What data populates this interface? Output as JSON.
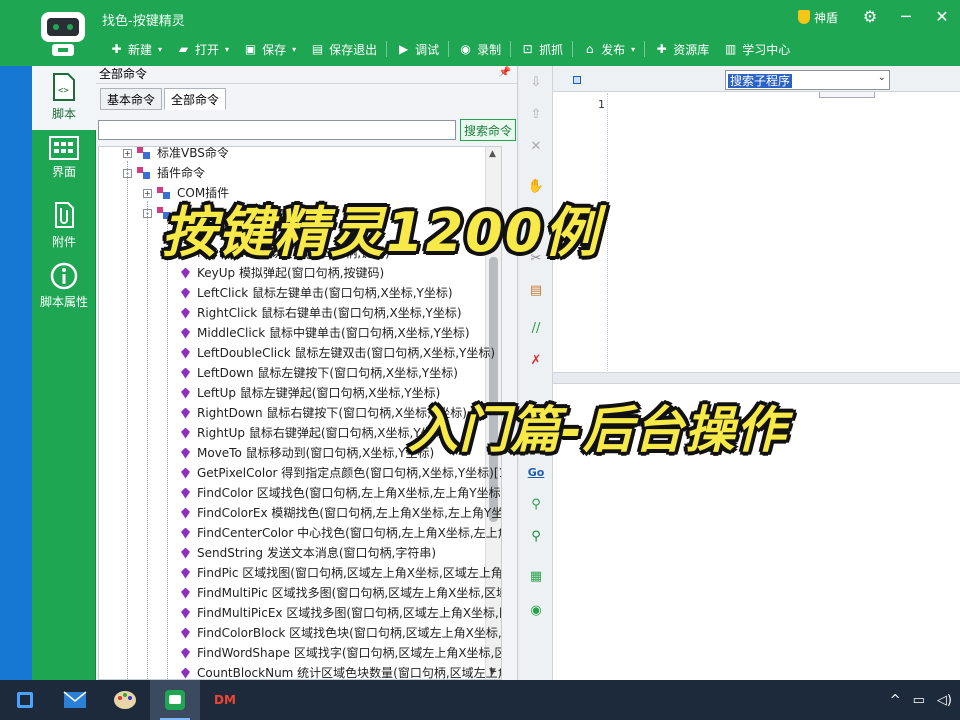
{
  "window": {
    "title": "找色-按键精灵"
  },
  "topbar": {
    "shield_label": "神盾",
    "toolbar": [
      {
        "icon": "plus-icon",
        "label": "新建",
        "dropdown": true
      },
      {
        "icon": "folder-open-icon",
        "label": "打开",
        "dropdown": true
      },
      {
        "icon": "save-icon",
        "label": "保存",
        "dropdown": true
      },
      {
        "icon": "save-exit-icon",
        "label": "保存退出",
        "dropdown": false
      },
      {
        "icon": "play-icon",
        "label": "调试",
        "dropdown": false
      },
      {
        "icon": "record-icon",
        "label": "录制",
        "dropdown": false
      },
      {
        "icon": "capture-icon",
        "label": "抓抓",
        "dropdown": false
      },
      {
        "icon": "publish-icon",
        "label": "发布",
        "dropdown": true
      },
      {
        "icon": "resource-icon",
        "label": "资源库",
        "dropdown": false
      },
      {
        "icon": "study-icon",
        "label": "学习中心",
        "dropdown": false
      }
    ]
  },
  "nav": {
    "items": [
      {
        "label": "脚本",
        "icon": "script-icon",
        "active": true
      },
      {
        "label": "界面",
        "icon": "ui-grid-icon",
        "active": false
      },
      {
        "label": "附件",
        "icon": "attachment-icon",
        "active": false
      },
      {
        "label": "脚本属性",
        "icon": "info-icon",
        "active": false
      }
    ]
  },
  "panel": {
    "title": "全部命令",
    "tabs": [
      "基本命令",
      "全部命令"
    ],
    "active_tab": 1,
    "search_value": "",
    "search_button": "搜索命令",
    "tree_roots": [
      {
        "label": "标准VBS命令",
        "expander": "+"
      },
      {
        "label": "插件命令",
        "expander": "-"
      }
    ],
    "tree_sub": [
      {
        "label": "COM插件",
        "expander": "+"
      },
      {
        "label": "",
        "expander": "-"
      }
    ],
    "commands": [
      "KeyDown 模拟按下(窗口句柄,键码)",
      "KeyUp 模拟弹起(窗口句柄,按键码)",
      "LeftClick 鼠标左键单击(窗口句柄,X坐标,Y坐标)",
      "RightClick 鼠标右键单击(窗口句柄,X坐标,Y坐标)",
      "MiddleClick 鼠标中键单击(窗口句柄,X坐标,Y坐标)",
      "LeftDoubleClick 鼠标左键双击(窗口句柄,X坐标,Y坐标)",
      "LeftDown 鼠标左键按下(窗口句柄,X坐标,Y坐标)",
      "LeftUp 鼠标左键弹起(窗口句柄,X坐标,Y坐标)",
      "RightDown 鼠标右键按下(窗口句柄,X坐标,Y坐标)",
      "RightUp 鼠标右键弹起(窗口句柄,X坐标,Y坐标)",
      "MoveTo 鼠标移动到(窗口句柄,X坐标,Y坐标)",
      "GetPixelColor 得到指定点颜色(窗口句柄,X坐标,Y坐标)[16",
      "FindColor 区域找色(窗口句柄,左上角X坐标,左上角Y坐标,",
      "FindColorEx 模糊找色(窗口句柄,左上角X坐标,左上角Y坐",
      "FindCenterColor 中心找色(窗口句柄,左上角X坐标,左上角",
      "SendString 发送文本消息(窗口句柄,字符串)",
      "FindPic 区域找图(窗口句柄,区域左上角X坐标,区域左上角Y",
      "FindMultiPic 区域找多图(窗口句柄,区域左上角X坐标,区域",
      "FindMultiPicEx 区域找多图(窗口句柄,区域左上角X坐标,区",
      "FindColorBlock 区域找色块(窗口句柄,区域左上角X坐标,区",
      "FindWordShape 区域找字(窗口句柄,区域左上角X坐标,区域",
      "CountBlockNum 统计区域色块数量(窗口句柄,区域左上角"
    ]
  },
  "vtoolbar": [
    "arrow-down-icon",
    "arrow-up-icon",
    "close-x-icon",
    "hand-icon",
    "copy-icon",
    "cut-icon",
    "paste-icon",
    "comment-icon",
    "uncomment-icon",
    "goto-icon",
    "find-icon",
    "replace-icon",
    "list-icon",
    "eye-icon"
  ],
  "editor": {
    "subroutine_select": "搜索子程序",
    "line_number": "1"
  },
  "captions": {
    "title": "按键精灵1200例",
    "subtitle": "入门篇-后台操作"
  },
  "taskbar": {
    "apps": [
      "start-icon",
      "mail-icon",
      "paint-icon",
      "anjian-app-icon",
      "dm-app-icon"
    ],
    "dm_label": "DM"
  }
}
